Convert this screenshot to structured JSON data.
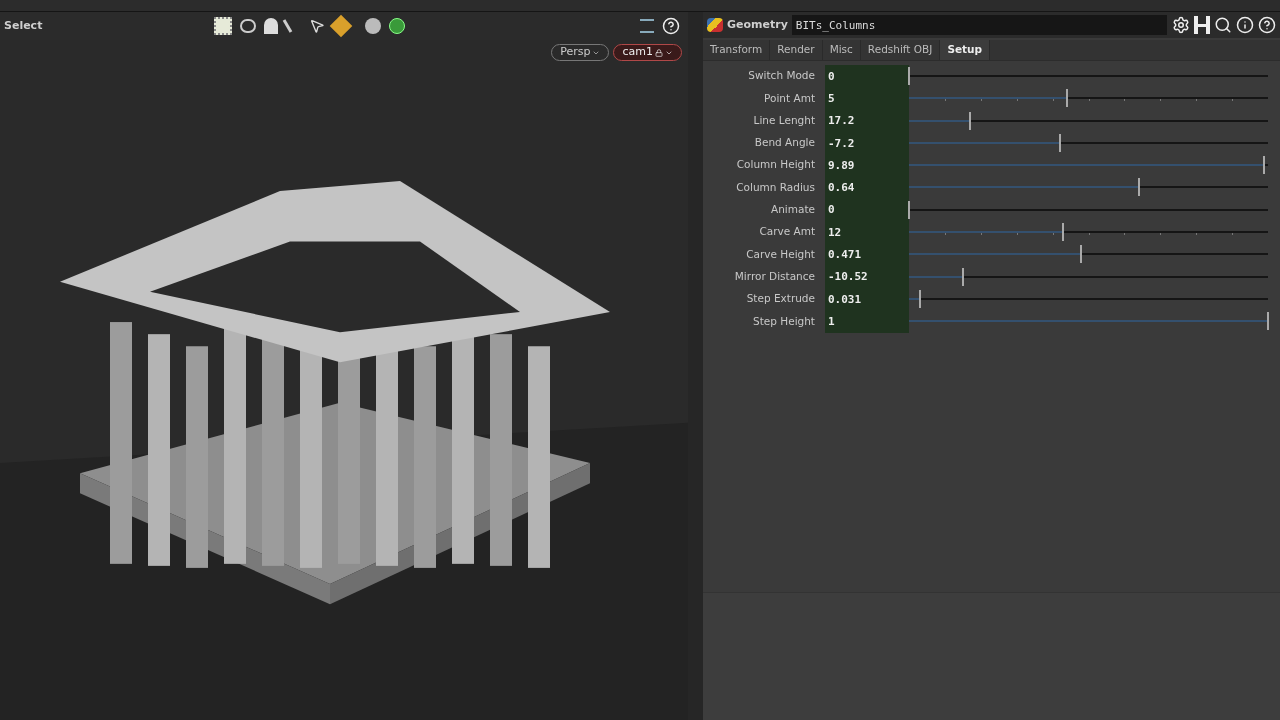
{
  "viewport": {
    "mode_label": "Select",
    "camera_menus": [
      {
        "label": "Persp",
        "kind": "view"
      },
      {
        "label": "cam1",
        "kind": "camera"
      }
    ]
  },
  "node": {
    "type": "Geometry",
    "name": "BITs_Columns"
  },
  "tabs": [
    {
      "label": "Transform",
      "selected": false
    },
    {
      "label": "Render",
      "selected": false
    },
    {
      "label": "Misc",
      "selected": false
    },
    {
      "label": "Redshift OBJ",
      "selected": false
    },
    {
      "label": "Setup",
      "selected": true
    }
  ],
  "parameters": [
    {
      "label": "Switch Mode",
      "value": "0",
      "level": 0,
      "ticks": false
    },
    {
      "label": "Point Amt",
      "value": "5",
      "level": 0.44,
      "ticks": true
    },
    {
      "label": "Line Lenght",
      "value": "17.2",
      "level": 0.17,
      "ticks": false
    },
    {
      "label": "Bend Angle",
      "value": "-7.2",
      "level": 0.42,
      "ticks": false
    },
    {
      "label": "Column Height",
      "value": "9.89",
      "level": 0.99,
      "ticks": false
    },
    {
      "label": "Column Radius",
      "value": "0.64",
      "level": 0.64,
      "ticks": false
    },
    {
      "label": "Animate",
      "value": "0",
      "level": 0,
      "ticks": false
    },
    {
      "label": "Carve Amt",
      "value": "12",
      "level": 0.43,
      "ticks": true
    },
    {
      "label": "Carve Height",
      "value": "0.471",
      "level": 0.48,
      "ticks": false
    },
    {
      "label": "Mirror Distance",
      "value": "-10.52",
      "level": 0.15,
      "ticks": false
    },
    {
      "label": "Step Extrude",
      "value": "0.031",
      "level": 0.03,
      "ticks": false
    },
    {
      "label": "Step Height",
      "value": "1",
      "level": 1,
      "ticks": false
    }
  ]
}
